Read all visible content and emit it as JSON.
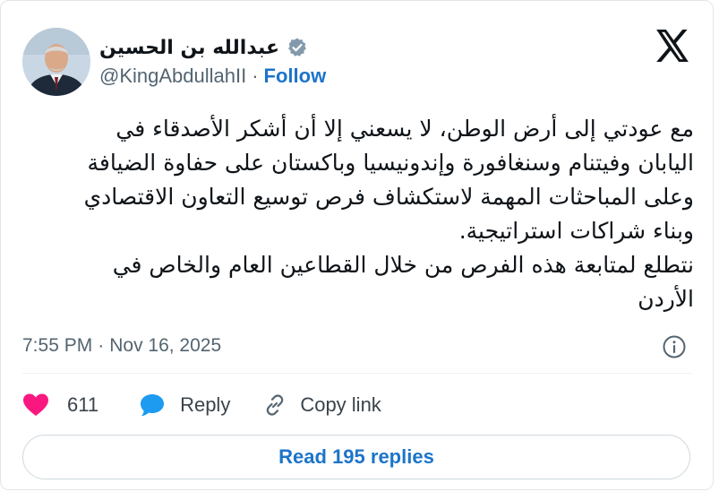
{
  "tweet": {
    "author": {
      "display_name": "عبدالله بن الحسين",
      "handle": "@KingAbdullahII",
      "verified": true
    },
    "follow_label": "Follow",
    "separator": "·",
    "text": "مع عودتي إلى أرض الوطن، لا يسعني إلا أن أشكر الأصدقاء في اليابان وفيتنام وسنغافورة وإندونيسيا وباكستان على حفاوة الضيافة وعلى المباحثات المهمة لاستكشاف فرص توسيع التعاون الاقتصادي وبناء شراكات استراتيجية.\nنتطلع لمتابعة هذه الفرص من خلال القطاعين العام والخاص في الأردن",
    "time": "7:55 PM",
    "date": "Nov 16, 2025",
    "likes": "611",
    "reply_label": "Reply",
    "copy_link_label": "Copy link",
    "read_replies_label": "Read 195 replies"
  },
  "icons": {
    "logo": "x-logo-icon",
    "verified": "verified-badge-icon",
    "info": "info-icon",
    "like": "heart-icon",
    "reply": "speech-bubble-icon",
    "copy": "link-icon"
  },
  "colors": {
    "accent": "#1d74c9",
    "like": "#f91880",
    "muted": "#536471",
    "text": "#0f1419"
  }
}
